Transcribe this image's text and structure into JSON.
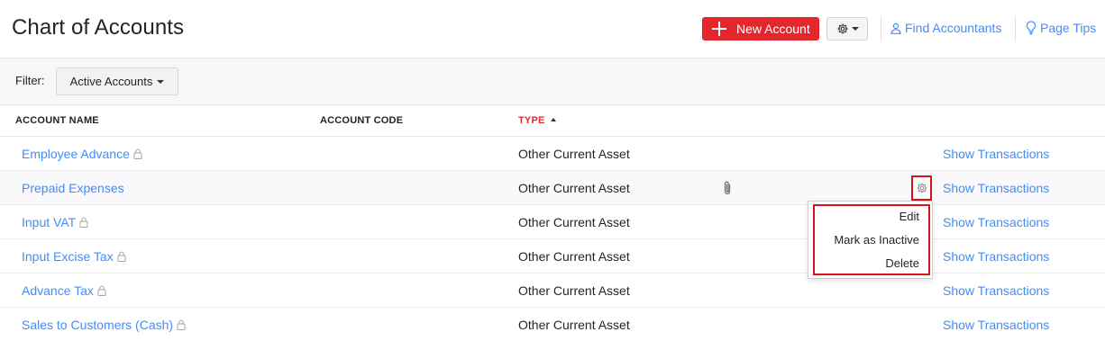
{
  "page": {
    "title": "Chart of Accounts"
  },
  "header": {
    "new_account_label": "New Account",
    "find_accountants_label": "Find Accountants",
    "page_tips_label": "Page Tips"
  },
  "filter": {
    "label": "Filter:",
    "value": "Active Accounts"
  },
  "table": {
    "columns": [
      "ACCOUNT NAME",
      "ACCOUNT CODE",
      "TYPE"
    ],
    "sorted_column": "TYPE",
    "sort_direction": "ascending",
    "show_transactions_label": "Show Transactions",
    "rows": [
      {
        "name": "Employee Advance",
        "code": "",
        "type": "Other Current Asset",
        "locked": true
      },
      {
        "name": "Prepaid Expenses",
        "code": "",
        "type": "Other Current Asset",
        "locked": false
      },
      {
        "name": "Input VAT",
        "code": "",
        "type": "Other Current Asset",
        "locked": true
      },
      {
        "name": "Input Excise Tax",
        "code": "",
        "type": "Other Current Asset",
        "locked": true
      },
      {
        "name": "Advance Tax",
        "code": "",
        "type": "Other Current Asset",
        "locked": true
      },
      {
        "name": "Sales to Customers (Cash)",
        "code": "",
        "type": "Other Current Asset",
        "locked": true
      }
    ]
  },
  "row_menu": {
    "items": [
      "Edit",
      "Mark as Inactive",
      "Delete"
    ]
  },
  "icons": {
    "new_account": "plus-icon",
    "settings": "gear-icon",
    "find_accountants": "user-icon",
    "page_tips": "lightbulb-icon",
    "locked_account": "lock-icon",
    "attachment": "paperclip-icon",
    "row_settings": "gear-icon"
  },
  "colors": {
    "primary_action": "#e3272d",
    "link": "#408dfb",
    "highlight_border": "#d9121b"
  }
}
